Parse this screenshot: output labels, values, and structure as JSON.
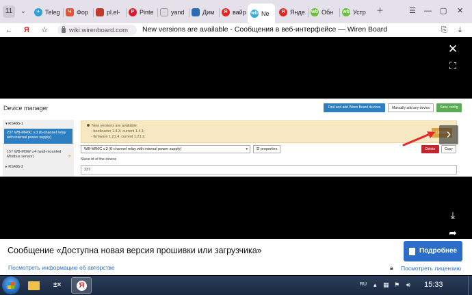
{
  "browser": {
    "tab_count": "11",
    "tabs": [
      {
        "label": "Teleg",
        "color": "#2aa0da",
        "glyph": "✈"
      },
      {
        "label": "Фор",
        "color": "#e0563a",
        "glyph": "Ч"
      },
      {
        "label": "pl.el-",
        "color": "#c0392b",
        "glyph": "▮"
      },
      {
        "label": "Pinte",
        "color": "#e2172b",
        "glyph": "P"
      },
      {
        "label": "yand",
        "color": "#e8e8e8",
        "glyph": "▮"
      },
      {
        "label": "Дим",
        "color": "#2d6bb5",
        "glyph": "▣"
      },
      {
        "label": "вайр",
        "color": "#e52620",
        "glyph": "Я"
      },
      {
        "label": "Ne",
        "color": "#3aa8d8",
        "glyph": "wb",
        "active": true
      },
      {
        "label": "Янде",
        "color": "#e52620",
        "glyph": "Я"
      },
      {
        "label": "Обн",
        "color": "#6cbf3b",
        "glyph": "wb"
      },
      {
        "label": "Устр",
        "color": "#6cbf3b",
        "glyph": "wb"
      }
    ],
    "url": "wiki.wirenboard.com",
    "page_title": "New versions are available - Сообщения в веб-интерфейсе — Wiren Board",
    "yandex_letter": "Я"
  },
  "device_manager": {
    "title": "Device manager",
    "buttons": {
      "find": "Find and add Wiren Board devices",
      "manual": "Manually add any device",
      "save": "Save config"
    },
    "sidebar": {
      "group1": "RS485-1",
      "active_item": "237 WB-MR6C v.3 (6-channel relay with internal power supply)",
      "item2": "157 WB-MSW v.4 (wall-mounted Modbus sensor)",
      "group2": "RS485-2"
    },
    "alert": {
      "heading": "New versions are available:",
      "line1": "- bootloader 1.4.3, current 1.4.1;",
      "line2": "- firmware 1.21.4, current 1.21.2.",
      "update_label": "Update"
    },
    "device_select": "WB-MR6C v.3 (6-channel relay with internal power supply)",
    "properties_label": "properties",
    "delete_label": "Delete",
    "copy_label": "Copy",
    "slave_label": "Slave id of the device",
    "slave_value": "237"
  },
  "info_panel": {
    "title": "Сообщение «Доступна новая версия прошивки или загрузчика»",
    "more_label": "Подробнее",
    "author_link": "Посмотреть информацию об авторстве",
    "license_link": "Посмотреть лицензию"
  },
  "taskbar": {
    "language": "RU",
    "clock": "15:33"
  }
}
